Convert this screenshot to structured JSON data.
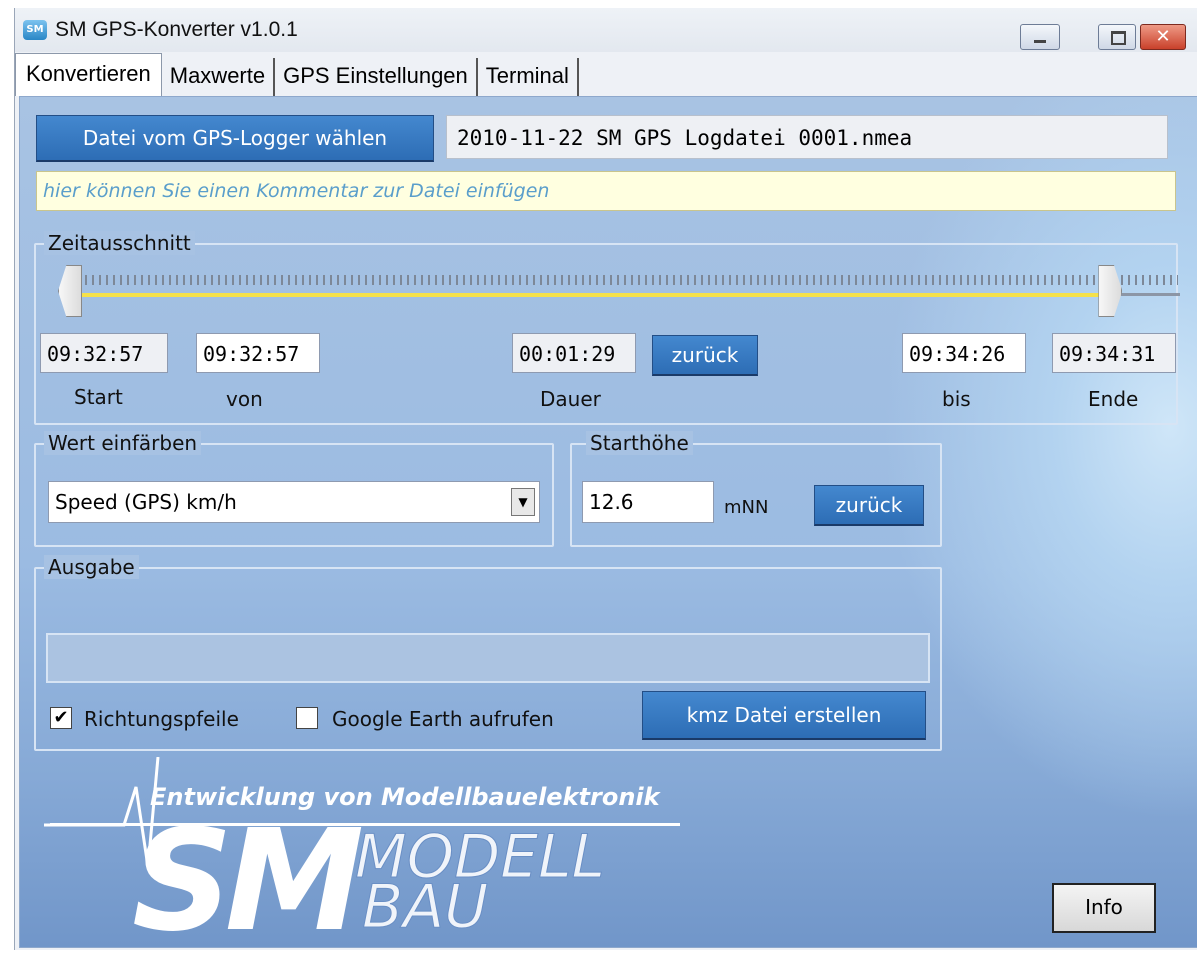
{
  "window": {
    "title": "SM GPS-Konverter v1.0.1",
    "app_icon_text": "SM",
    "close_symbol": "✕"
  },
  "tabs": [
    "Konvertieren",
    "Maxwerte",
    "GPS Einstellungen",
    "Terminal"
  ],
  "file": {
    "choose_button": "Datei vom GPS-Logger wählen",
    "filename": "2010-11-22 SM GPS Logdatei 0001.nmea",
    "comment_placeholder": "hier können Sie einen Kommentar zur Datei einfügen"
  },
  "zeitausschnitt": {
    "label": "Zeitausschnitt",
    "start_value": "09:32:57",
    "von_value": "09:32:57",
    "dauer_value": "00:01:29",
    "bis_value": "09:34:26",
    "ende_value": "09:34:31",
    "start_label": "Start",
    "von_label": "von",
    "dauer_label": "Dauer",
    "bis_label": "bis",
    "ende_label": "Ende",
    "reset_button": "zurück",
    "slider_from_fraction": 0.0,
    "slider_to_fraction": 0.945
  },
  "wert_einfaerben": {
    "label": "Wert einfärben",
    "selected": "Speed (GPS) km/h",
    "dropdown_arrow": "▼"
  },
  "starthoehe": {
    "label": "Starthöhe",
    "value": "12.6",
    "unit": "mNN",
    "reset_button": "zurück"
  },
  "ausgabe": {
    "label": "Ausgabe",
    "output_text": "",
    "richtungspfeile_label": "Richtungspfeile",
    "richtungspfeile_checked": true,
    "google_earth_label": "Google Earth aufrufen",
    "google_earth_checked": false,
    "kmz_button": "kmz Datei erstellen"
  },
  "logo": {
    "tagline": "Entwicklung von Modellbauelektronik",
    "sm": "SM",
    "modell": "MODELL",
    "bau": "BAU"
  },
  "info_button": "Info"
}
